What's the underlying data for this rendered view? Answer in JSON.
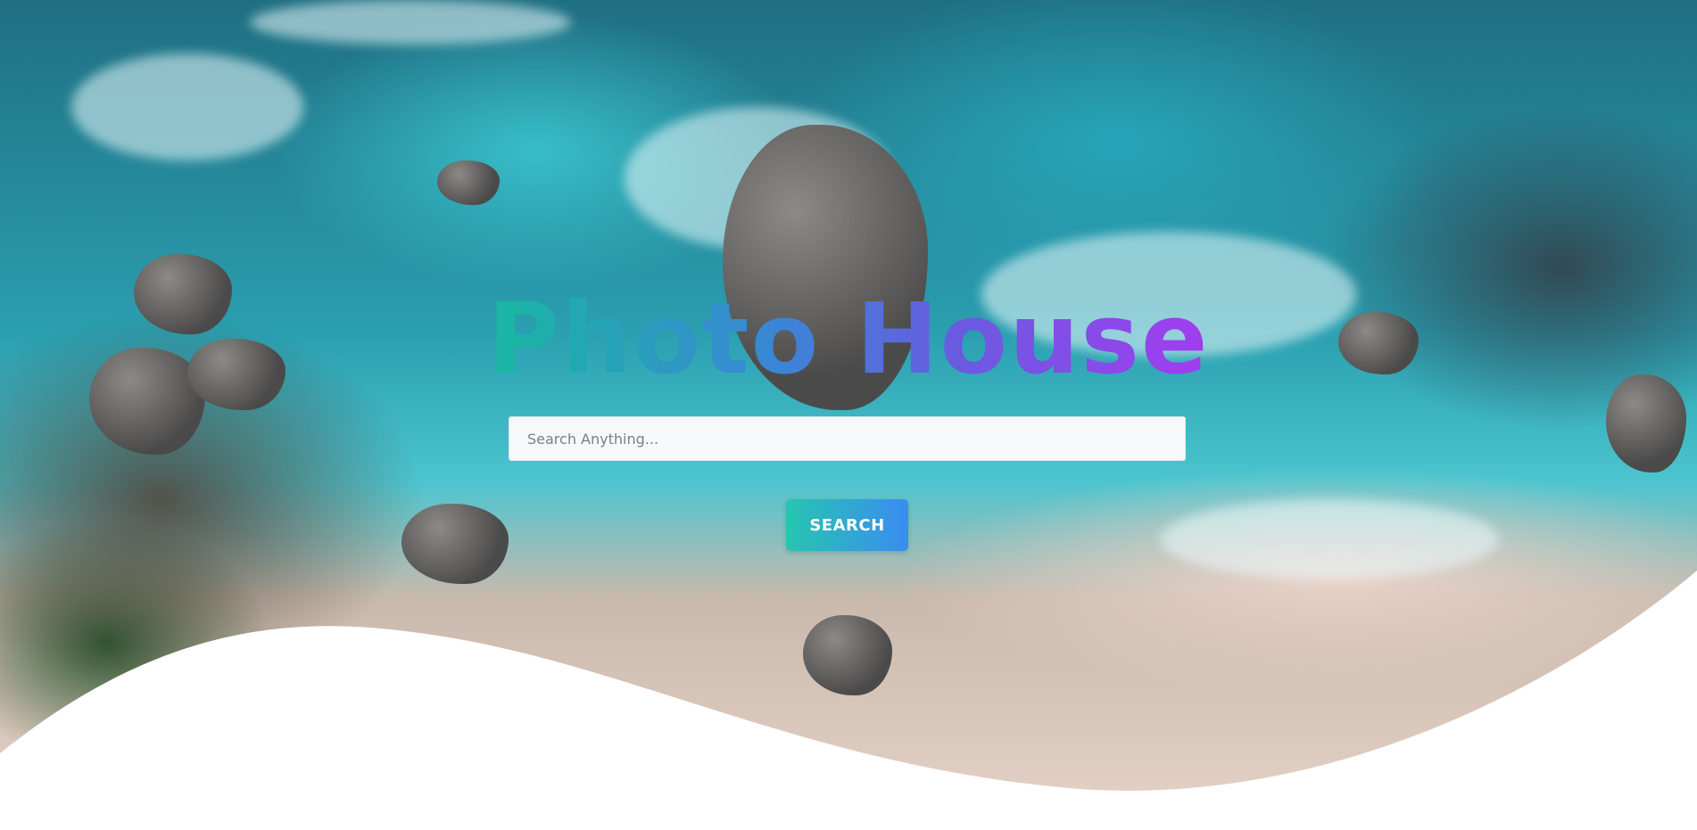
{
  "hero": {
    "title": "Photo House",
    "background_image": "aerial-ocean-beach-rocks"
  },
  "search": {
    "placeholder": "Search Anything...",
    "value": "",
    "button_label": "SEARCH"
  },
  "colors": {
    "title_gradient": [
      "#18b8a0",
      "#3a86d6",
      "#6a5be0",
      "#a23cf0"
    ],
    "button_gradient": [
      "#26c6b0",
      "#3a8cf0"
    ],
    "input_background": "#f7f8fa",
    "page_background": "#ffffff"
  }
}
